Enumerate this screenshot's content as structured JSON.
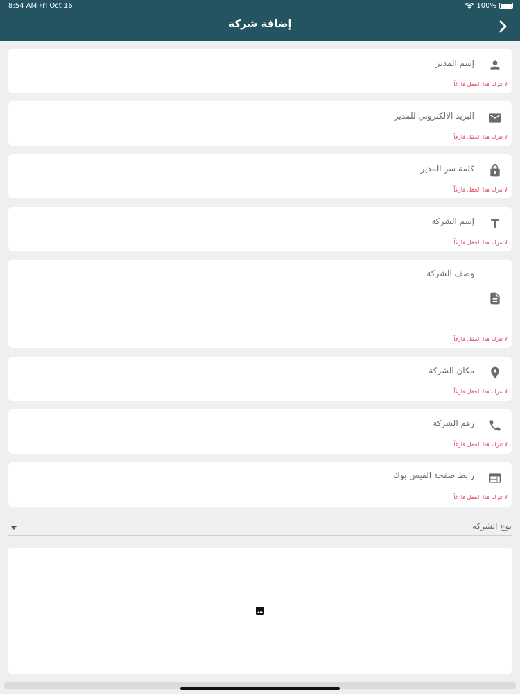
{
  "status_bar": {
    "time_date": "8:54 AM   Fri Oct 16",
    "battery": "100%"
  },
  "header": {
    "title": "إضافة شركة"
  },
  "fields": [
    {
      "label": "إسم المدير",
      "error": "لا تترك هذا الحقل فارغاً",
      "icon": "person-icon"
    },
    {
      "label": "البريد الالكتروني للمدير",
      "error": "لا تترك هذا الحقل فارغاً",
      "icon": "email-icon"
    },
    {
      "label": "كلمة سر المدير",
      "error": "لا تترك هذا الحقل فارغاً",
      "icon": "lock-icon"
    },
    {
      "label": "إسم الشركة",
      "error": "لا تترك هذا الحقل فارغاً",
      "icon": "text-icon"
    },
    {
      "label": "وصف الشركة",
      "error": "لا تترك هذا الحقل فارغاً",
      "icon": "document-icon"
    },
    {
      "label": "مكان الشركة",
      "error": "لا تترك هذا الحقل فارغاً",
      "icon": "location-pin-icon"
    },
    {
      "label": "رقم الشركة",
      "error": "لا تترك هذا الحقل فارغاً",
      "icon": "phone-icon"
    },
    {
      "label": "رابط صفحة الفيس بوك",
      "error": "لا تترك هذا الحقل فارغاً",
      "icon": "web-page-icon"
    }
  ],
  "company_type": {
    "label": "نوع الشركة"
  },
  "image_picker": {
    "icon": "image-icon"
  },
  "colors": {
    "app_bar": "#245361",
    "error": "#e0445a",
    "icon": "#6b6b6b",
    "background": "#efeff0"
  }
}
